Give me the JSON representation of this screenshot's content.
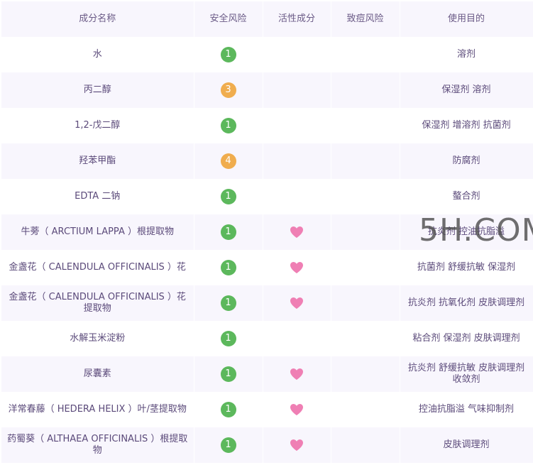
{
  "table": {
    "headers": {
      "name": "成分名称",
      "safety": "安全风险",
      "active": "活性成分",
      "acne": "致痘风险",
      "purpose": "使用目的"
    },
    "rows": [
      {
        "name": "水",
        "safety": "1",
        "active": false,
        "purpose": "溶剂"
      },
      {
        "name": "丙二醇",
        "safety": "3",
        "active": false,
        "purpose": "保湿剂 溶剂"
      },
      {
        "name": "1,2-戊二醇",
        "safety": "1",
        "active": false,
        "purpose": "保湿剂 增溶剂 抗菌剂"
      },
      {
        "name": "羟苯甲酯",
        "safety": "4",
        "active": false,
        "purpose": "防腐剂"
      },
      {
        "name": "EDTA 二钠",
        "safety": "1",
        "active": false,
        "purpose": "螯合剂"
      },
      {
        "name": "牛蒡（ ARCTIUM LAPPA ）根提取物",
        "safety": "1",
        "active": true,
        "purpose": "抗炎剂 控油抗脂溢"
      },
      {
        "name": "金盏花（ CALENDULA OFFICINALIS ）花",
        "safety": "1",
        "active": true,
        "purpose": "抗菌剂 舒缓抗敏 保湿剂"
      },
      {
        "name": "金盏花（ CALENDULA OFFICINALIS ）花提取物",
        "safety": "1",
        "active": true,
        "purpose": "抗炎剂 抗氧化剂 皮肤调理剂"
      },
      {
        "name": "水解玉米淀粉",
        "safety": "1",
        "active": false,
        "purpose": "粘合剂 保湿剂 皮肤调理剂"
      },
      {
        "name": "尿囊素",
        "safety": "1",
        "active": true,
        "purpose": "抗炎剂 舒缓抗敏 皮肤调理剂 收敛剂"
      },
      {
        "name": "洋常春藤（ HEDERA HELIX ）叶/茎提取物",
        "safety": "1",
        "active": true,
        "purpose": "控油抗脂溢 气味抑制剂"
      },
      {
        "name": "药蜀葵（ ALTHAEA OFFICINALIS ）根提取物",
        "safety": "1",
        "active": true,
        "purpose": "皮肤调理剂"
      }
    ]
  },
  "watermark": "5H.COM",
  "icons": {
    "active": "heart-icon"
  },
  "colors": {
    "safety_low": "#5cb85c",
    "safety_mid": "#f0ad4e",
    "heart": "#ef7fb4",
    "header_bg": "#f8f6fd",
    "text": "#5b4a7a"
  }
}
